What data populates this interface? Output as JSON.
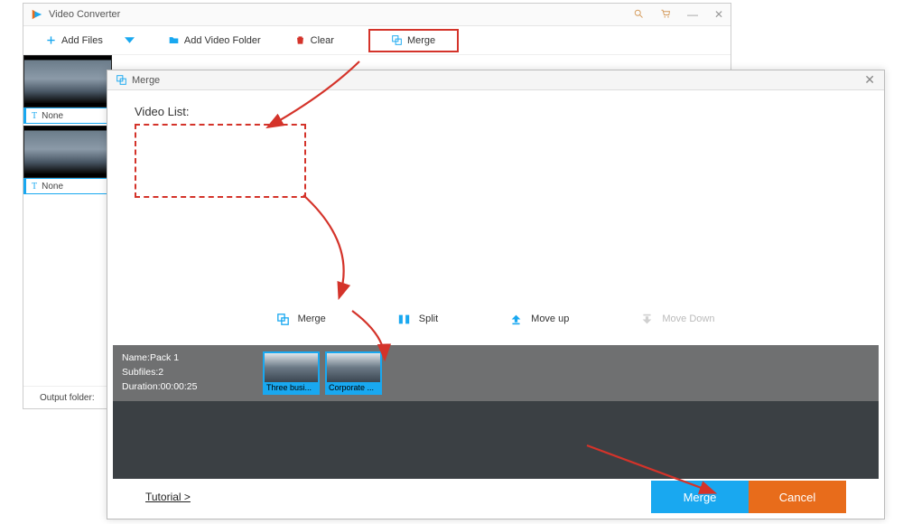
{
  "main_window": {
    "title": "Video Converter",
    "toolbar": {
      "add_files": "Add Files",
      "add_folder": "Add Video Folder",
      "clear": "Clear",
      "merge": "Merge"
    },
    "thumbs": [
      {
        "label": "None"
      },
      {
        "label": "None"
      }
    ],
    "output_folder_label": "Output folder:"
  },
  "merge_dialog": {
    "title": "Merge",
    "list_label": "Video List:",
    "actions": {
      "merge": "Merge",
      "split": "Split",
      "move_up": "Move up",
      "move_down": "Move Down"
    },
    "pack": {
      "name_label": "Name:",
      "name": "Pack 1",
      "subfiles_label": "Subfiles:",
      "subfiles": "2",
      "duration_label": "Duration:",
      "duration": "00:00:25",
      "thumbs": [
        {
          "label": "Three busi..."
        },
        {
          "label": "Corporate ..."
        }
      ]
    },
    "footer": {
      "tutorial": "Tutorial >",
      "merge_btn": "Merge",
      "cancel_btn": "Cancel"
    }
  },
  "colors": {
    "primary": "#19a8f0",
    "danger": "#d4332a",
    "warn": "#e86c1b"
  }
}
